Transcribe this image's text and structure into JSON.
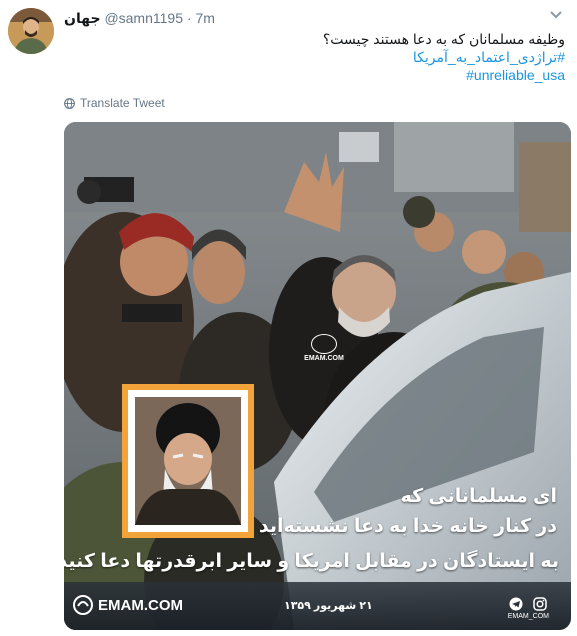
{
  "tweet": {
    "author_name": "جهان",
    "handle": "@samn1195",
    "separator": "·",
    "time": "7m",
    "text_line": "وظیفه مسلمانان که به دعا هستند چیست؟",
    "hashtags": [
      "#تراژدی_اعتماد_به_آمریکا",
      "#unreliable_usa"
    ],
    "translate_label": "Translate Tweet"
  },
  "media": {
    "watermark": "EMAM.COM",
    "caption_lines": [
      "ای مسلمانانی که",
      "در کنار خانه خدا به دعا نشسته‌اید",
      "به ایستادگان در مقابل امریکا و سایر ابرقدرتها دعا کنید"
    ],
    "footer_logo": "EMAM.COM",
    "date": "۲۱ شهریور ۱۳۵۹",
    "footer_site": "EMAM_COM"
  },
  "colors": {
    "link": "#1b95e0",
    "muted": "#657786",
    "frame": "#f2a33a"
  },
  "icons": {
    "caret": "chevron-down-icon",
    "translate": "globe-icon",
    "telegram": "telegram-icon",
    "instagram": "instagram-icon"
  }
}
